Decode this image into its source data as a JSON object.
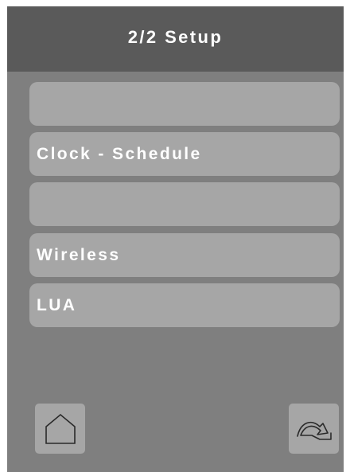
{
  "header": {
    "title": "2/2 Setup"
  },
  "menu": {
    "items": [
      {
        "label": ""
      },
      {
        "label": "Clock - Schedule"
      },
      {
        "label": ""
      },
      {
        "label": "Wireless"
      },
      {
        "label": "LUA"
      }
    ]
  },
  "footer": {
    "home_icon": "home-icon",
    "forward_icon": "forward-arrow-icon"
  },
  "colors": {
    "header_background": "#5a5a5a",
    "screen_background": "#7f7f7f",
    "button_background": "#a6a6a6",
    "text": "#ffffff"
  }
}
